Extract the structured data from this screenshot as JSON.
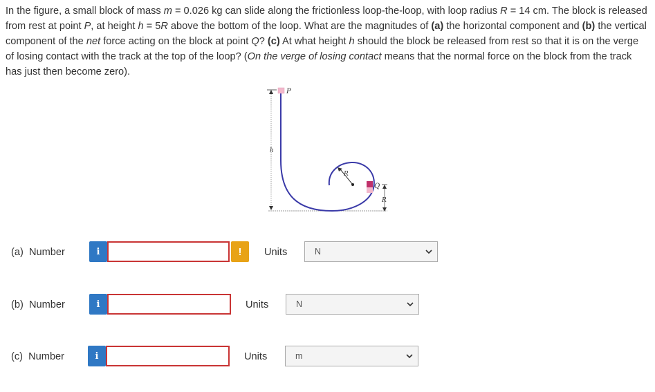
{
  "question": {
    "p1": "In the figure, a small block of mass ",
    "m_var": "m",
    "p2": " = 0.026 kg can slide along the frictionless loop-the-loop, with loop radius ",
    "R_var": "R",
    "p3": " = 14 cm. The block is released from rest at point ",
    "P_var": "P",
    "p4": ", at height ",
    "h_var": "h",
    "p5": " = 5",
    "R_var2": "R",
    "p6": " above the bottom of the loop. What are the magnitudes of ",
    "a_tag": "(a)",
    "p7": " the horizontal component and ",
    "b_tag": "(b)",
    "p8": " the vertical component of the ",
    "net_word": "net",
    "p9": " force acting on the block at point ",
    "Q_var": "Q",
    "p10": "? ",
    "c_tag": "(c)",
    "p11": " At what height ",
    "h_var2": "h",
    "p12": " should the block be released from rest so that it is on the verge of losing contact with the track at the top of the loop? (",
    "verge_phrase": "On the verge of losing contact",
    "p13": " means that the normal force on the block from the track has just then become zero)."
  },
  "figure": {
    "label_P": "P",
    "label_h": "h",
    "label_R": "R",
    "label_Q": "Q",
    "label_R2": "R",
    "track_color": "#3a3aa8",
    "block_color": "#c0306a"
  },
  "rows": [
    {
      "label": "(a)  Number",
      "units_label": "Units",
      "unit": "N",
      "info_icon": "i",
      "warn_icon": "!"
    },
    {
      "label": "(b)  Number",
      "units_label": "Units",
      "unit": "N",
      "info_icon": "i"
    },
    {
      "label": "(c)  Number",
      "units_label": "Units",
      "unit": "m",
      "info_icon": "i"
    }
  ],
  "colors": {
    "info": "#2f78c4",
    "warning": "#e8a317",
    "input_border_error": "#c93434"
  }
}
